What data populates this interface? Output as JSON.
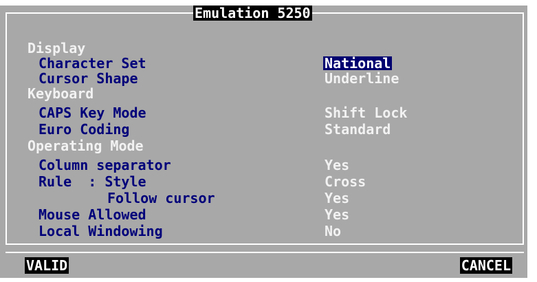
{
  "window": {
    "title": "Emulation 5250"
  },
  "settings": {
    "display": {
      "section_label": "Display",
      "character_set": {
        "label": "Character Set",
        "value": "National"
      },
      "cursor_shape": {
        "label": "Cursor Shape",
        "value": "Underline"
      }
    },
    "keyboard": {
      "section_label": "Keyboard",
      "caps_key_mode": {
        "label": "CAPS Key Mode",
        "value": "Shift Lock"
      },
      "euro_coding": {
        "label": "Euro Coding",
        "value": "Standard"
      }
    },
    "operating_mode": {
      "section_label": "Operating Mode",
      "column_separator": {
        "label": "Column separator",
        "value": "Yes"
      },
      "rule_style": {
        "label": "Rule  : Style",
        "value": "Cross"
      },
      "follow_cursor": {
        "label": "Follow cursor",
        "value": "Yes"
      },
      "mouse_allowed": {
        "label": "Mouse Allowed",
        "value": "Yes"
      },
      "local_windowing": {
        "label": "Local Windowing",
        "value": "No"
      }
    }
  },
  "buttons": {
    "valid": "VALID",
    "cancel": "CANCEL"
  },
  "colors": {
    "background": "#a8a8a8",
    "label_blue": "#00007a",
    "value_white": "#f2f2f2",
    "selected_bg": "#000070"
  }
}
